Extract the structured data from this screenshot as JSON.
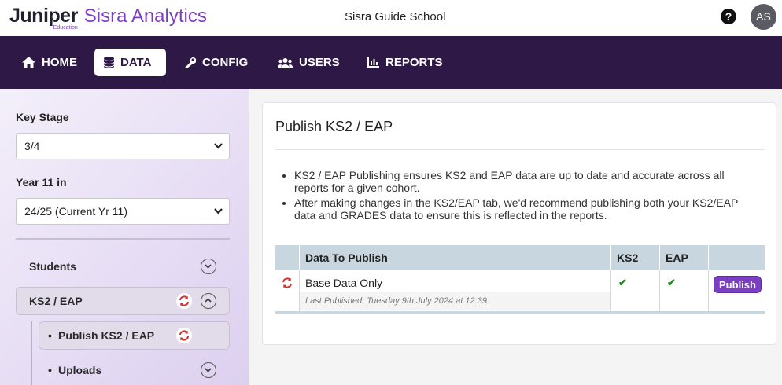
{
  "header": {
    "brand_name": "Juniper",
    "brand_sub": "Education",
    "product_name": "Sisra Analytics",
    "school": "Sisra Guide School",
    "avatar_initials": "AS"
  },
  "nav": {
    "items": [
      {
        "label": "HOME",
        "icon": "home-icon"
      },
      {
        "label": "DATA",
        "icon": "database-icon",
        "active": true
      },
      {
        "label": "CONFIG",
        "icon": "wrench-icon"
      },
      {
        "label": "USERS",
        "icon": "users-icon"
      },
      {
        "label": "REPORTS",
        "icon": "chart-icon"
      }
    ]
  },
  "sidebar": {
    "key_stage_label": "Key Stage",
    "key_stage_value": "3/4",
    "year_label": "Year 11 in",
    "year_value": "24/25 (Current Yr 11)",
    "items": [
      {
        "label": "Students"
      },
      {
        "label": "KS2 / EAP"
      },
      {
        "label": "Publish KS2 / EAP",
        "bullet": "•"
      },
      {
        "label": "Uploads",
        "bullet": "•"
      }
    ]
  },
  "main": {
    "title": "Publish KS2 / EAP",
    "bullets": [
      "KS2 / EAP Publishing ensures KS2 and EAP data are up to date and accurate across all reports for a given cohort.",
      "After making changes in the KS2/EAP tab, we'd recommend publishing both your KS2/EAP data and GRADES data to ensure this is reflected in the reports."
    ],
    "table": {
      "headers": [
        "Data To Publish",
        "KS2",
        "EAP"
      ],
      "row": {
        "name": "Base Data Only",
        "last_published": "Last Published: Tuesday 9th July 2024 at 12:39",
        "ks2": "✔",
        "eap": "✔",
        "action": "Publish"
      }
    }
  },
  "colors": {
    "nav_bg": "#2e1846",
    "accent": "#7b3fc4",
    "table_header": "#c8d6e0",
    "refresh_red": "#d32f2f"
  }
}
